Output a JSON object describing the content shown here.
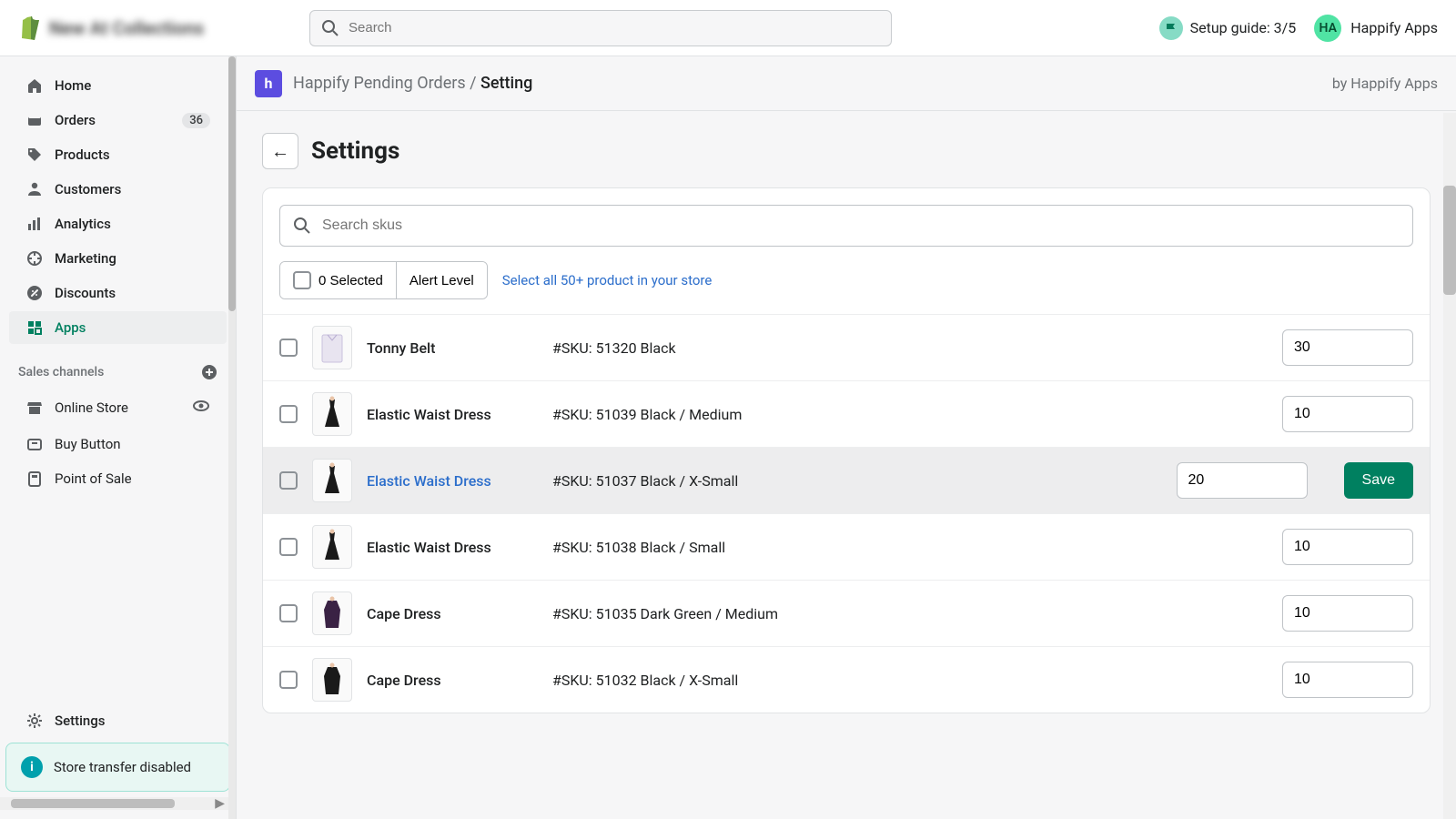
{
  "topbar": {
    "store_name": "New At Collections",
    "search_placeholder": "Search",
    "setup_guide": "Setup guide: 3/5",
    "user_initials": "HA",
    "user_name": "Happify Apps"
  },
  "sidebar": {
    "items": [
      {
        "label": "Home",
        "icon": "home"
      },
      {
        "label": "Orders",
        "icon": "orders",
        "badge": "36"
      },
      {
        "label": "Products",
        "icon": "tag"
      },
      {
        "label": "Customers",
        "icon": "person"
      },
      {
        "label": "Analytics",
        "icon": "analytics"
      },
      {
        "label": "Marketing",
        "icon": "target"
      },
      {
        "label": "Discounts",
        "icon": "discount"
      },
      {
        "label": "Apps",
        "icon": "apps",
        "active": true
      }
    ],
    "sales_channels_label": "Sales channels",
    "channels": [
      {
        "label": "Online Store",
        "icon": "store",
        "view": true
      },
      {
        "label": "Buy Button",
        "icon": "buy"
      },
      {
        "label": "Point of Sale",
        "icon": "pos"
      }
    ],
    "settings_label": "Settings",
    "banner_text": "Store transfer disabled"
  },
  "breadcrumb": {
    "app_initial": "h",
    "app_name": "Happify Pending Orders",
    "separator": "/",
    "current": "Setting",
    "by_text": "by Happify Apps"
  },
  "page": {
    "title": "Settings",
    "sku_search_placeholder": "Search skus",
    "selected_label": "0 Selected",
    "alert_level_label": "Alert Level",
    "select_all_label": "Select all 50+ product in your store",
    "save_label": "Save"
  },
  "rows": [
    {
      "name": "Tonny Belt",
      "sku": "#SKU: 51320 Black",
      "value": "30",
      "thumb": "shirt"
    },
    {
      "name": "Elastic Waist Dress",
      "sku": "#SKU: 51039 Black / Medium",
      "value": "10",
      "thumb": "dress"
    },
    {
      "name": "Elastic Waist Dress",
      "sku": "#SKU: 51037 Black / X-Small",
      "value": "20",
      "thumb": "dress",
      "highlighted": true,
      "show_save": true,
      "linkish": true
    },
    {
      "name": "Elastic Waist Dress",
      "sku": "#SKU: 51038 Black / Small",
      "value": "10",
      "thumb": "dress"
    },
    {
      "name": "Cape Dress",
      "sku": "#SKU: 51035 Dark Green / Medium",
      "value": "10",
      "thumb": "cape"
    },
    {
      "name": "Cape Dress",
      "sku": "#SKU: 51032 Black / X-Small",
      "value": "10",
      "thumb": "cape2"
    }
  ]
}
